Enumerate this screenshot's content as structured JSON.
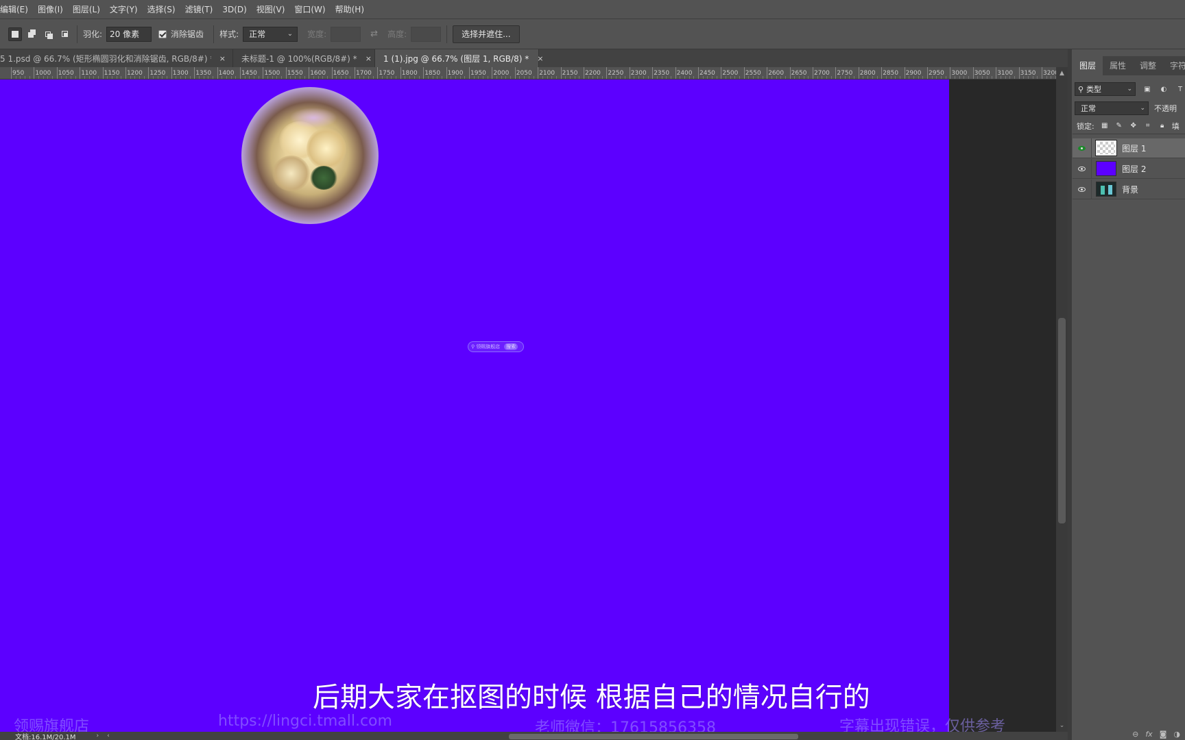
{
  "menu": [
    "编辑(E)",
    "图像(I)",
    "图层(L)",
    "文字(Y)",
    "选择(S)",
    "滤镜(T)",
    "3D(D)",
    "视图(V)",
    "窗口(W)",
    "帮助(H)"
  ],
  "options": {
    "feather_label": "羽化:",
    "feather_value": "20 像素",
    "antialias_label": "消除锯齿",
    "antialias_checked": true,
    "style_label": "样式:",
    "style_value": "正常",
    "width_label": "宽度:",
    "height_label": "高度:",
    "mask_button": "选择并遮住..."
  },
  "tabs": [
    {
      "label": "5 1.psd @ 66.7% (矩形椭圆羽化和消除锯齿, RGB/8#) *",
      "active": false
    },
    {
      "label": "未标题-1 @ 100%(RGB/8#) *",
      "active": false
    },
    {
      "label": "1 (1).jpg @ 66.7% (图层 1, RGB/8) *",
      "active": true
    }
  ],
  "ruler": {
    "labels": [
      "950",
      "1000",
      "1050",
      "1100",
      "1150",
      "1200",
      "1250",
      "1300",
      "1350",
      "1400",
      "1450",
      "1500",
      "1550",
      "1600",
      "1650",
      "1700",
      "1750",
      "1800",
      "1850",
      "1900",
      "1950",
      "2000",
      "2050",
      "2100",
      "2150",
      "2200",
      "2250",
      "2300",
      "2350",
      "2400",
      "2450",
      "2500",
      "2550",
      "2600",
      "2650",
      "2700",
      "2750",
      "2800",
      "2850",
      "2900",
      "2950",
      "3000",
      "3050",
      "3100",
      "3150",
      "3200"
    ]
  },
  "canvas": {
    "fill_color": "#5c00ff",
    "badge_text": "领赐旗舰店",
    "badge_pill": "搜索"
  },
  "overlay": {
    "subtitle": "后期大家在抠图的时候 根据自己的情况自行的",
    "watermarks": [
      "领赐旗舰店",
      "https://lingci.tmall.com",
      "老师微信：17615856358",
      "字幕出现错误，仅供参考"
    ]
  },
  "status": {
    "doc_info": "文档:16.1M/20.1M"
  },
  "panel": {
    "tabs": [
      "图层",
      "属性",
      "调整",
      "字符"
    ],
    "active_tab": "图层",
    "kind_filter": "类型",
    "blend_mode": "正常",
    "opacity_label": "不透明",
    "lock_label": "锁定:",
    "fill_label": "填",
    "layers": [
      {
        "name": "图层 1",
        "selected": true,
        "thumb": "transparent"
      },
      {
        "name": "图层 2",
        "selected": false,
        "thumb": "purple"
      },
      {
        "name": "背景",
        "selected": false,
        "thumb": "background"
      }
    ],
    "footer_icons": [
      "link-icon",
      "fx-icon",
      "mask-icon",
      "adjustment-icon"
    ]
  }
}
